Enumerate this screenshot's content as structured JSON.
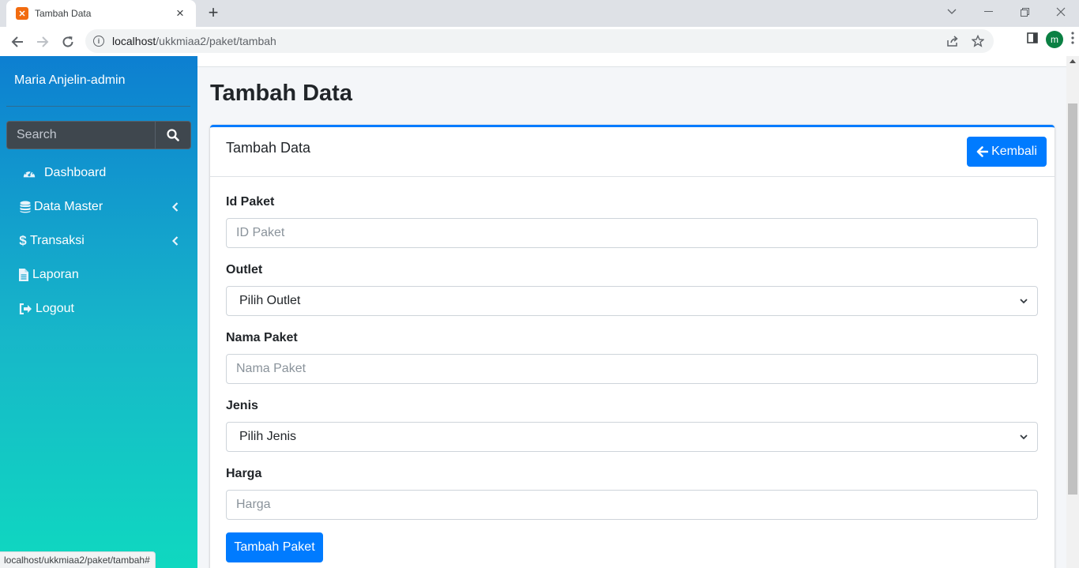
{
  "browser": {
    "tab_title": "Tambah Data",
    "url_host": "localhost",
    "url_path": "/ukkmiaa2/paket/tambah",
    "profile_initial": "m",
    "status_url": "localhost/ukkmiaa2/paket/tambah#"
  },
  "sidebar": {
    "brand": "Maria Anjelin-admin",
    "search_placeholder": "Search",
    "items": [
      {
        "label": "Dashboard",
        "icon": "dashboard-icon"
      },
      {
        "label": "Data Master",
        "icon": "database-icon",
        "has_children": true
      },
      {
        "label": "Transaksi",
        "icon": "dollar-icon",
        "has_children": true
      },
      {
        "label": "Laporan",
        "icon": "file-icon"
      },
      {
        "label": "Logout",
        "icon": "sign-out-icon"
      }
    ]
  },
  "page": {
    "title": "Tambah Data",
    "card_title": "Tambah Data",
    "back_label": "Kembali",
    "fields": {
      "id_paket": {
        "label": "Id Paket",
        "placeholder": "ID Paket"
      },
      "outlet": {
        "label": "Outlet",
        "selected": "Pilih Outlet"
      },
      "nama_paket": {
        "label": "Nama Paket",
        "placeholder": "Nama Paket"
      },
      "jenis": {
        "label": "Jenis",
        "selected": "Pilih Jenis"
      },
      "harga": {
        "label": "Harga",
        "placeholder": "Harga"
      }
    },
    "submit_label": "Tambah Paket"
  },
  "colors": {
    "primary": "#007bff",
    "sidebar_top": "#0d7fd1",
    "sidebar_bottom": "#0fd8c0"
  }
}
